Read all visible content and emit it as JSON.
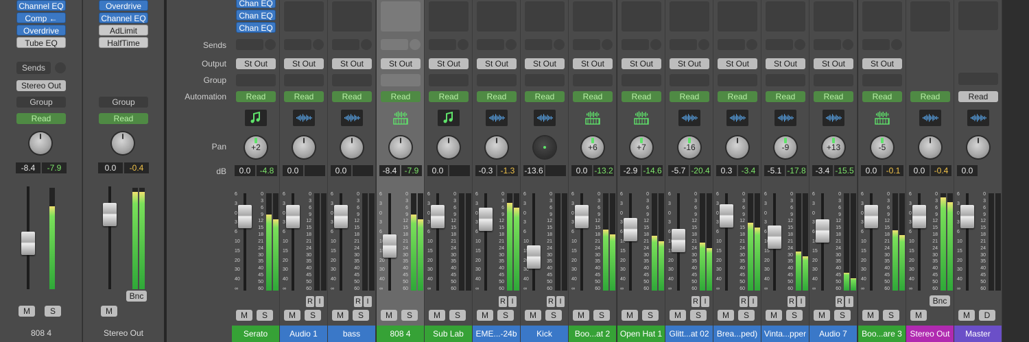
{
  "row_labels": {
    "sends": "Sends",
    "output": "Output",
    "group": "Group",
    "automation": "Automation",
    "pan": "Pan",
    "db": "dB"
  },
  "inspector_left": {
    "plugins": [
      "Channel EQ",
      "Comp ←",
      "Overdrive",
      "Tube EQ"
    ],
    "sends_label": "Sends",
    "output": "Stereo Out",
    "group": "Group",
    "automation": "Read",
    "db_value": "-8.4",
    "peak_value": "-7.9",
    "mute": "M",
    "solo": "S",
    "name": "808 4"
  },
  "inspector_right": {
    "plugins": [
      "Overdrive",
      "Channel EQ",
      "AdLimit",
      "HalfTime"
    ],
    "group": "Group",
    "automation": "Read",
    "db_value": "0.0",
    "peak_value": "-0.4",
    "bounce": "Bnc",
    "mute": "M",
    "name": "Stereo Out"
  },
  "top_plugins": [
    "Chan EQ",
    "Chan EQ",
    "Chan EQ"
  ],
  "meter_scale": [
    "0",
    "3",
    "6",
    "9",
    "12",
    "15",
    "18",
    "21",
    "24",
    "30",
    "35",
    "40",
    "45",
    "50",
    "60"
  ],
  "fader_scale": [
    "6",
    "3",
    "0",
    "3",
    "6",
    "10",
    "15",
    "20",
    "30",
    "40",
    "∞"
  ],
  "strips": [
    {
      "name": "Serato",
      "color": "#36a236",
      "output": "St Out",
      "automation": "Read",
      "icon": "music",
      "pan": "+2",
      "db": "0.0",
      "peak": "-4.8",
      "peak_color": "green",
      "ri": false,
      "ms": [
        "M",
        "S"
      ]
    },
    {
      "name": "Audio 1",
      "color": "#3a78c8",
      "output": "St Out",
      "automation": "Read",
      "icon": "wave",
      "pan": "",
      "db": "0.0",
      "peak": "",
      "peak_color": "green",
      "ri": true,
      "ms": [
        "M",
        "S"
      ]
    },
    {
      "name": "bass",
      "color": "#3a78c8",
      "output": "St Out",
      "automation": "Read",
      "icon": "wave",
      "pan": "",
      "db": "0.0",
      "peak": "",
      "peak_color": "green",
      "ri": true,
      "ms": [
        "M",
        "S"
      ]
    },
    {
      "name": "808 4",
      "color": "#36a236",
      "output": "St Out",
      "automation": "Read",
      "icon": "keys",
      "pan": "",
      "db": "-8.4",
      "peak": "-7.9",
      "peak_color": "green",
      "ri": false,
      "ms": [
        "M",
        "S"
      ]
    },
    {
      "name": "Sub Lab",
      "color": "#36a236",
      "output": "St Out",
      "automation": "Read",
      "icon": "music",
      "pan": "",
      "db": "0.0",
      "peak": "",
      "peak_color": "green",
      "ri": false,
      "ms": [
        "M",
        "S"
      ]
    },
    {
      "name": "EME...-24b",
      "color": "#3a78c8",
      "output": "St Out",
      "automation": "Read",
      "icon": "wave",
      "pan": "",
      "db": "-0.3",
      "peak": "-1.3",
      "peak_color": "yellow",
      "ri": true,
      "ms": [
        "M",
        "S"
      ]
    },
    {
      "name": "Kick",
      "color": "#3a78c8",
      "output": "St Out",
      "automation": "Read",
      "icon": "wave",
      "pan": "",
      "db": "-13.6",
      "peak": "",
      "peak_color": "green",
      "ri": true,
      "ms": [
        "M",
        "S"
      ]
    },
    {
      "name": "Boo...at 2",
      "color": "#36a236",
      "output": "St Out",
      "automation": "Read",
      "icon": "keys",
      "pan": "+6",
      "db": "0.0",
      "peak": "-13.2",
      "peak_color": "green",
      "ri": false,
      "ms": [
        "M",
        "S"
      ]
    },
    {
      "name": "Open Hat 1",
      "color": "#36a236",
      "output": "St Out",
      "automation": "Read",
      "icon": "keys",
      "pan": "+7",
      "db": "-2.9",
      "peak": "-14.6",
      "peak_color": "green",
      "ri": false,
      "ms": [
        "M",
        "S"
      ]
    },
    {
      "name": "Glitt...at 02",
      "color": "#3a78c8",
      "output": "St Out",
      "automation": "Read",
      "icon": "wave",
      "pan": "-16",
      "db": "-5.7",
      "peak": "-20.4",
      "peak_color": "green",
      "ri": true,
      "ms": [
        "M",
        "S"
      ]
    },
    {
      "name": "Brea...ped)",
      "color": "#3a78c8",
      "output": "St Out",
      "automation": "Read",
      "icon": "wave",
      "pan": "",
      "db": "0.3",
      "peak": "-3.4",
      "peak_color": "green",
      "ri": true,
      "ms": [
        "M",
        "S"
      ]
    },
    {
      "name": "Vinta...pper",
      "color": "#3a78c8",
      "output": "St Out",
      "automation": "Read",
      "icon": "wave",
      "pan": "-9",
      "db": "-5.1",
      "peak": "-17.8",
      "peak_color": "green",
      "ri": true,
      "ms": [
        "M",
        "S"
      ]
    },
    {
      "name": "Audio 7",
      "color": "#3a78c8",
      "output": "St Out",
      "automation": "Read",
      "icon": "wave",
      "pan": "+13",
      "db": "-3.4",
      "peak": "-15.5",
      "peak_color": "green",
      "ri": true,
      "ms": [
        "M",
        "S"
      ]
    },
    {
      "name": "Boo...are 3",
      "color": "#36a236",
      "output": "St Out",
      "automation": "Read",
      "icon": "keys",
      "pan": "-5",
      "db": "0.0",
      "peak": "-0.1",
      "peak_color": "yellow",
      "ri": false,
      "ms": [
        "M",
        "S"
      ]
    },
    {
      "name": "Stereo Out",
      "color": "#b02ab0",
      "output": "",
      "automation": "Read",
      "icon": "wave",
      "pan": "",
      "db": "0.0",
      "peak": "-0.4",
      "peak_color": "yellow",
      "ri": false,
      "bnc": "Bnc",
      "ms": [
        "M"
      ]
    },
    {
      "name": "Master",
      "color": "#6b4fc8",
      "output": "",
      "automation": "Read",
      "icon": "wave",
      "pan": "",
      "db": "0.0",
      "peak": "",
      "peak_color": "green",
      "ri": false,
      "ms": [
        "M",
        "D"
      ],
      "gray_read": true
    }
  ]
}
